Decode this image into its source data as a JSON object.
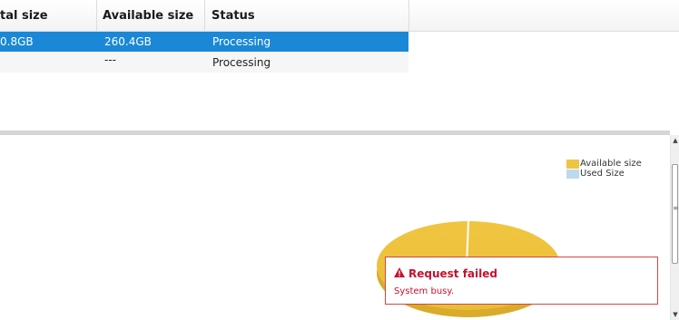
{
  "table": {
    "columns": [
      "tal size",
      "Available size",
      "Status"
    ],
    "rows": [
      {
        "total_size": "0.8GB",
        "available_size": "260.4GB",
        "status": "Processing",
        "selected": true
      },
      {
        "total_size": "",
        "available_size": "---",
        "status": "Processing",
        "selected": false
      }
    ]
  },
  "chart": {
    "legend": [
      {
        "label": "Available size",
        "color": "#eec443"
      },
      {
        "label": "Used Size",
        "color": "#bcd9ee"
      }
    ]
  },
  "chart_data": {
    "type": "pie",
    "series": [
      {
        "name": "Available size",
        "color": "#eec443"
      },
      {
        "name": "Used Size",
        "color": "#bcd9ee"
      }
    ]
  },
  "toast": {
    "icon": "warning-icon",
    "title": "Request failed",
    "message": "System busy."
  },
  "colors": {
    "selection": "#1a88d6",
    "error": "#c8102e"
  }
}
